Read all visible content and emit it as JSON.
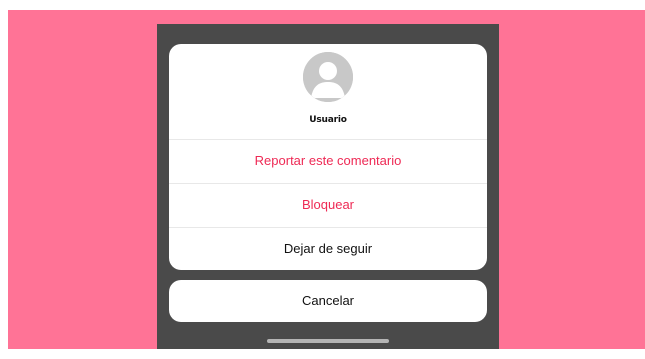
{
  "sheet": {
    "username": "Usuario",
    "options": [
      {
        "label": "Reportar este comentario",
        "style": "danger"
      },
      {
        "label": "Bloquear",
        "style": "danger"
      },
      {
        "label": "Dejar de seguir",
        "style": "normal"
      }
    ],
    "cancel_label": "Cancelar"
  },
  "colors": {
    "background": "#ff7396",
    "overlay": "#4a4a4a",
    "danger_text": "#ee2a55",
    "avatar": "#c8c8c8"
  },
  "icons": {
    "avatar": "person-silhouette-icon"
  }
}
